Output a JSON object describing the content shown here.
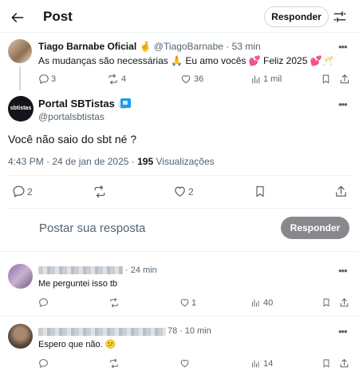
{
  "header": {
    "title": "Post",
    "reply_button": "Responder"
  },
  "parent_post": {
    "author_name": "Tiago Barnabe Oficial",
    "verified_emoji": "🤞",
    "handle": "@TiagoBarnabe",
    "time": "· 53 min",
    "text": "As mudanças são necessárias 🙏 Eu amo vocês 💕 Feliz 2025 💕🥂",
    "replies": "3",
    "reposts": "4",
    "likes": "36",
    "views": "1 mil"
  },
  "main_post": {
    "author_name": "Portal SBTistas",
    "badge_emoji": "🍥",
    "handle": "@portalsbtistas",
    "avatar_text": "sbtistas",
    "text": "Você não saio do sbt né ?",
    "timestamp": "4:43 PM · 24 de jan de 2025 · ",
    "views_count": "195",
    "views_label": "Visualizações",
    "replies": "2",
    "likes": "2"
  },
  "composer": {
    "placeholder": "Postar sua resposta",
    "button": "Responder"
  },
  "replies": [
    {
      "time": "· 24 min",
      "text": "Me perguntei isso tb",
      "likes": "1",
      "views": "40"
    },
    {
      "handle_suffix": "78",
      "time": "· 10 min",
      "text": "Espero que não. 😕",
      "views": "14"
    }
  ],
  "colors": {
    "text": "#0f1419",
    "muted": "#536471",
    "divider": "#eff3f4",
    "disabled_button": "#87898c",
    "heart": "#f91880"
  }
}
